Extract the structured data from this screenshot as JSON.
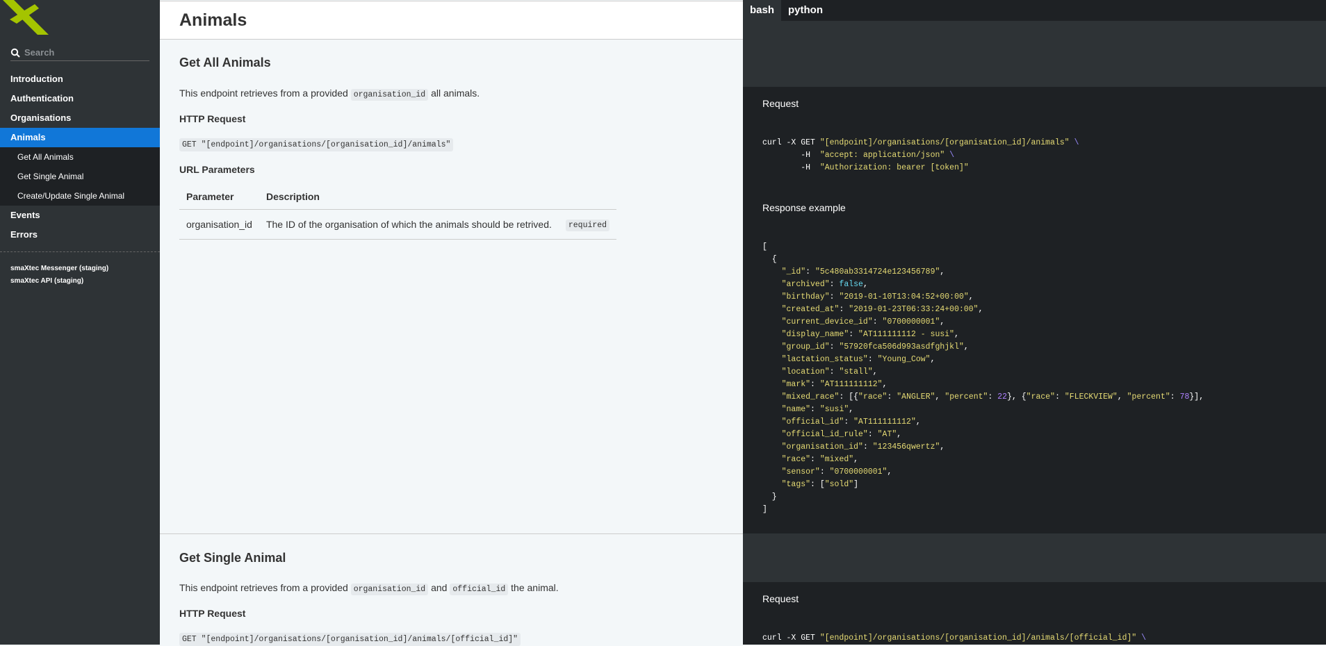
{
  "sidebar": {
    "logo_alt": "smaXtec logo",
    "search_placeholder": "Search",
    "items": [
      {
        "label": "Introduction"
      },
      {
        "label": "Authentication"
      },
      {
        "label": "Organisations"
      },
      {
        "label": "Animals",
        "active": true
      },
      {
        "label": "Events"
      },
      {
        "label": "Errors"
      }
    ],
    "sub_items": [
      {
        "label": "Get All Animals"
      },
      {
        "label": "Get Single Animal"
      },
      {
        "label": "Create/Update Single Animal"
      }
    ],
    "footer_links": [
      {
        "label": "smaXtec Messenger (staging)"
      },
      {
        "label": "smaXtec API (staging)"
      }
    ]
  },
  "main": {
    "page_title": "Animals",
    "get_all": {
      "title": "Get All Animals",
      "desc_prefix": "This endpoint retrieves from a provided ",
      "desc_code": "organisation_id",
      "desc_suffix": " all animals.",
      "http_heading": "HTTP Request",
      "http_request": "GET \"[endpoint]/organisations/[organisation_id]/animals\"",
      "url_params_heading": "URL Parameters",
      "table": {
        "headers": [
          "Parameter",
          "Description"
        ],
        "rows": [
          {
            "parameter": "organisation_id",
            "description": "The ID of the organisation of which the animals should be retrived.",
            "badge": "required"
          }
        ]
      }
    },
    "get_single": {
      "title": "Get Single Animal",
      "desc_prefix": "This endpoint retrieves from a provided ",
      "desc_code1": "organisation_id",
      "desc_mid": " and ",
      "desc_code2": "official_id",
      "desc_suffix": " the animal.",
      "http_heading": "HTTP Request",
      "http_request": "GET \"[endpoint]/organisations/[organisation_id]/animals/[official_id]\""
    }
  },
  "code_panel": {
    "tabs": [
      {
        "label": "bash",
        "active": true
      },
      {
        "label": "python"
      }
    ],
    "request_label": "Request",
    "response_label": "Response example",
    "request1": {
      "cmd": "curl -X GET ",
      "url": "\"[endpoint]/organisations/[organisation_id]/animals\"",
      "h_flag": "-H",
      "header1": "\"accept: application/json\"",
      "header2": "\"Authorization: bearer [token]\""
    },
    "response": {
      "_id": "\"5c480ab3314724e123456789\"",
      "archived": "false",
      "birthday": "\"2019-01-10T13:04:52+00:00\"",
      "created_at": "\"2019-01-23T06:33:24+00:00\"",
      "current_device_id": "\"0700000001\"",
      "display_name": "\"AT111111112 - susi\"",
      "group_id": "\"57920fca506d993asdfghjkl\"",
      "lactation_status": "\"Young_Cow\"",
      "location": "\"stall\"",
      "mark": "\"AT111111112\"",
      "mixed_race": {
        "race1": "\"ANGLER\"",
        "percent1": "22",
        "race2": "\"FLECKVIEW\"",
        "percent2": "78"
      },
      "name": "\"susi\"",
      "official_id": "\"AT111111112\"",
      "official_id_rule": "\"AT\"",
      "organisation_id": "\"123456qwertz\"",
      "race": "\"mixed\"",
      "sensor": "\"0700000001\"",
      "tags": "\"sold\""
    },
    "request2": {
      "cmd": "curl -X GET ",
      "url": "\"[endpoint]/organisations/[organisation_id]/animals/[official_id]\""
    }
  }
}
